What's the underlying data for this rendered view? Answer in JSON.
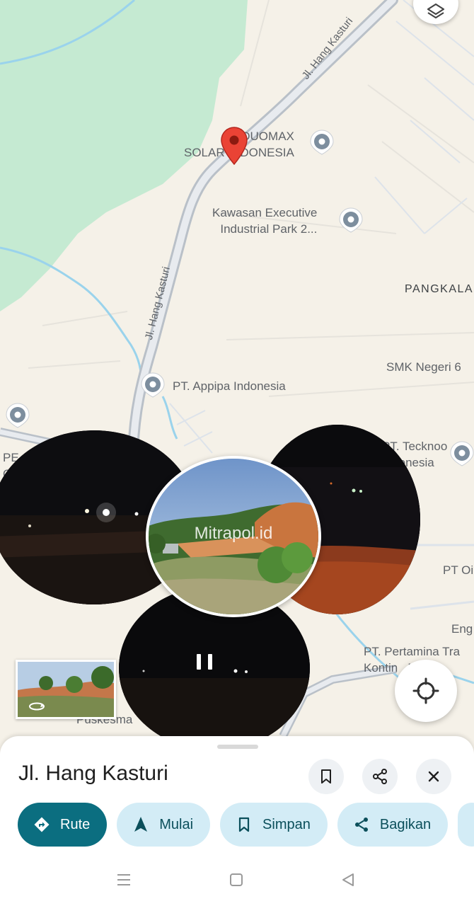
{
  "map": {
    "road_labels": [
      "Jl. Hang Kasturi",
      "Jl. Hang Kasturi"
    ],
    "places": [
      {
        "name": "DUOMAX\nSOLAR INDONESIA",
        "icon": "poi-marker-icon"
      },
      {
        "name": "Kawasan Executive\nIndustrial Park 2...",
        "icon": "poi-marker-icon"
      },
      {
        "name": "PT. Appipa Indonesia",
        "icon": "poi-marker-icon"
      },
      {
        "name": "SMK Negeri 6"
      },
      {
        "name": "PT. Tecknoo\nIndonesia",
        "icon": "poi-marker-icon"
      },
      {
        "name": "PT Oi"
      },
      {
        "name": "Eng"
      },
      {
        "name": "PT. Pertamina Tra\nKontin   MBOI"
      },
      {
        "name": "Puskesma"
      },
      {
        "name": "PE\nO"
      }
    ],
    "area_label": "PANGKALA",
    "photo_watermark": "Mitrapol.id",
    "colors": {
      "green_area": "#c5ead2",
      "water": "#9ad3ec",
      "road": "#c6ccd3",
      "land": "#f5f1e8",
      "pin": "#ea4335"
    }
  },
  "buttons": {
    "layers": "layers-icon",
    "locate": "my-location-icon",
    "pause": "pause-icon",
    "street_view": "360-rotate-icon"
  },
  "sheet": {
    "title": "Jl. Hang Kasturi",
    "actions": [
      "bookmark-icon",
      "share-icon",
      "close-icon"
    ],
    "chips": [
      {
        "label": "Rute",
        "icon": "directions-icon",
        "primary": true
      },
      {
        "label": "Mulai",
        "icon": "navigation-arrow-icon"
      },
      {
        "label": "Simpan",
        "icon": "bookmark-icon"
      },
      {
        "label": "Bagikan",
        "icon": "share-icon"
      }
    ]
  },
  "system_nav": [
    "menu-icon",
    "home-icon",
    "back-icon"
  ]
}
